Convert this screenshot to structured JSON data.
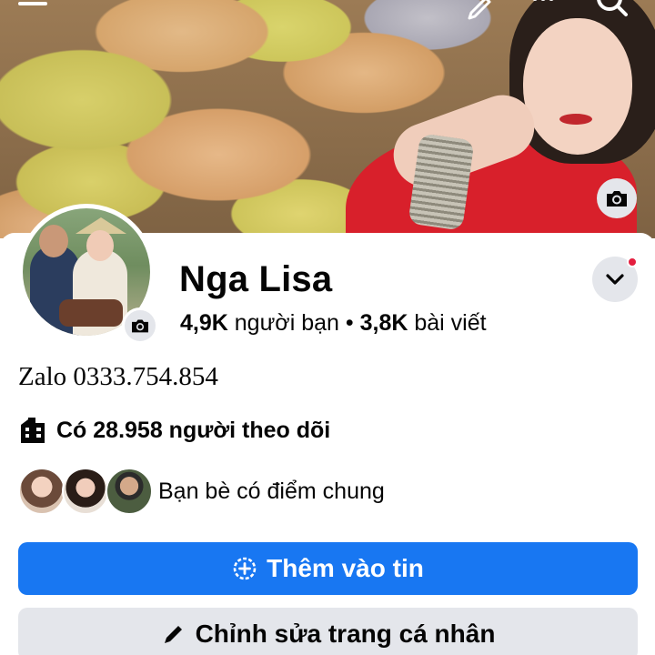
{
  "profile": {
    "name": "Nga Lisa",
    "friends_count": "4,9K",
    "friends_label": "người bạn",
    "separator": "•",
    "posts_count": "3,8K",
    "posts_label": "bài viết",
    "bio": "Zalo 0333.754.854",
    "followers_text": "Có 28.958 người theo dõi",
    "mutual_text": "Bạn bè có điểm chung"
  },
  "buttons": {
    "add_story": "Thêm vào tin",
    "edit_profile": "Chỉnh sửa trang cá nhân"
  },
  "icons": {
    "top_bar": [
      "menu-icon",
      "edit-icon",
      "more-icon",
      "search-icon"
    ],
    "cover": "camera-icon",
    "avatar": "camera-icon",
    "dropdown": "chevron-down-icon",
    "followers": "building-icon",
    "add_story": "plus-circle-icon",
    "edit_profile": "pencil-icon"
  },
  "colors": {
    "primary": "#1877f2",
    "secondary_button": "#e4e6eb",
    "notification_dot": "#e41e3f",
    "text": "#050505"
  }
}
